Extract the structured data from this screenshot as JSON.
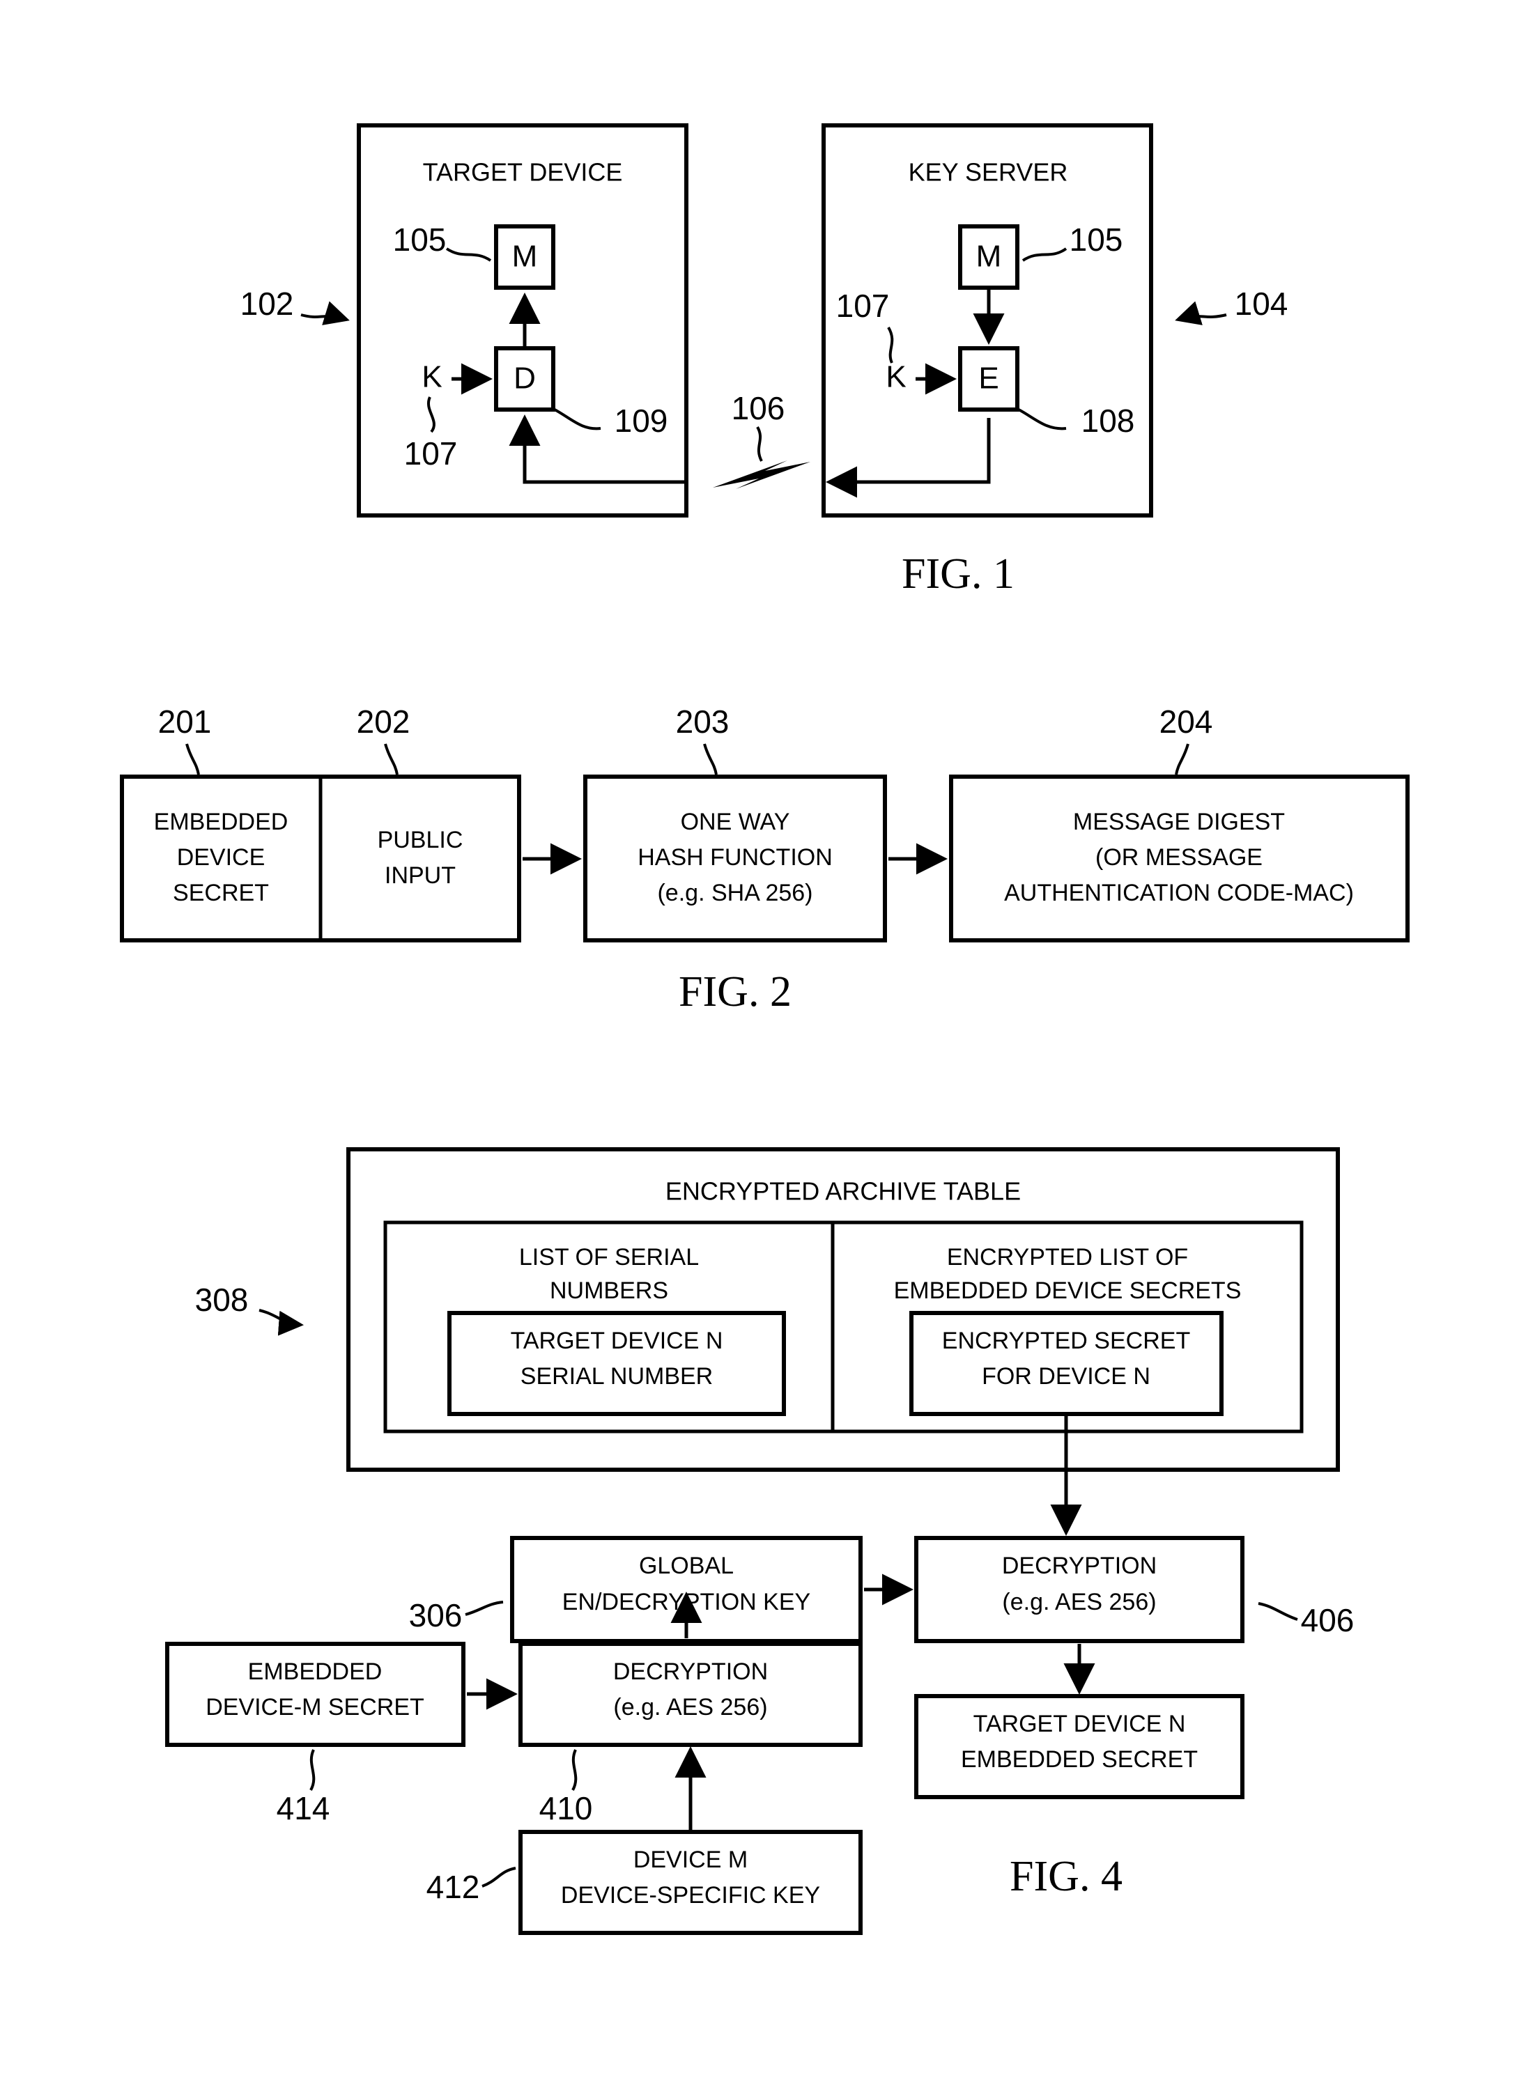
{
  "document": {
    "type": "patent-drawing-sheet",
    "background_color": "#ffffff",
    "ink_color": "#000000"
  },
  "figures": [
    {
      "id": "fig1",
      "caption": "FIG. 1",
      "refs": {
        "target_device": "102",
        "key_server": "104",
        "message_target": "105",
        "message_server": "105",
        "key_target": "107",
        "key_server_key": "107",
        "channel": "106",
        "encrypt": "108",
        "decrypt": "109"
      },
      "target_device": {
        "title": "TARGET DEVICE",
        "message_box": "M",
        "decrypt_box": "D",
        "key_glyph": "K"
      },
      "key_server": {
        "title": "KEY SERVER",
        "message_box": "M",
        "encrypt_box": "E",
        "key_glyph": "K"
      }
    },
    {
      "id": "fig2",
      "caption": "FIG. 2",
      "refs": {
        "embedded_device_secret": "201",
        "public_input": "202",
        "hash_function": "203",
        "message_digest": "204"
      },
      "blocks": [
        {
          "id": "embedded-device-secret",
          "lines": [
            "EMBEDDED",
            "DEVICE",
            "SECRET"
          ]
        },
        {
          "id": "public-input",
          "lines": [
            "PUBLIC",
            "INPUT"
          ]
        },
        {
          "id": "one-way-hash-function",
          "lines": [
            "ONE WAY",
            "HASH FUNCTION",
            "(e.g. SHA 256)"
          ]
        },
        {
          "id": "message-digest",
          "lines": [
            "MESSAGE DIGEST",
            "(OR MESSAGE",
            "AUTHENTICATION CODE-MAC)"
          ]
        }
      ]
    },
    {
      "id": "fig4",
      "caption": "FIG. 4",
      "refs": {
        "encrypted_archive_table": "308",
        "global_key": "306",
        "archive_decryption": "406",
        "device_decryption": "410",
        "device_specific_key": "412",
        "embedded_device_m_secret": "414"
      },
      "archive_table": {
        "title": "ENCRYPTED ARCHIVE TABLE",
        "left_column_header": [
          "LIST OF SERIAL",
          "NUMBERS"
        ],
        "right_column_header": [
          "ENCRYPTED LIST OF",
          "EMBEDDED DEVICE SECRETS"
        ],
        "left_cell": [
          "TARGET DEVICE N",
          "SERIAL NUMBER"
        ],
        "right_cell": [
          "ENCRYPTED SECRET",
          "FOR DEVICE N"
        ]
      },
      "blocks": [
        {
          "id": "global-en-decryption-key",
          "lines": [
            "GLOBAL",
            "EN/DECRYPTION KEY"
          ]
        },
        {
          "id": "archive-decryption",
          "lines": [
            "DECRYPTION",
            "(e.g. AES 256)"
          ]
        },
        {
          "id": "embedded-device-m-secret",
          "lines": [
            "EMBEDDED",
            "DEVICE-M SECRET"
          ]
        },
        {
          "id": "device-decryption",
          "lines": [
            "DECRYPTION",
            "(e.g. AES 256)"
          ]
        },
        {
          "id": "target-device-n-embedded-secret",
          "lines": [
            "TARGET DEVICE N",
            "EMBEDDED SECRET"
          ]
        },
        {
          "id": "device-m-device-specific-key",
          "lines": [
            "DEVICE M",
            "DEVICE-SPECIFIC KEY"
          ]
        }
      ]
    }
  ]
}
